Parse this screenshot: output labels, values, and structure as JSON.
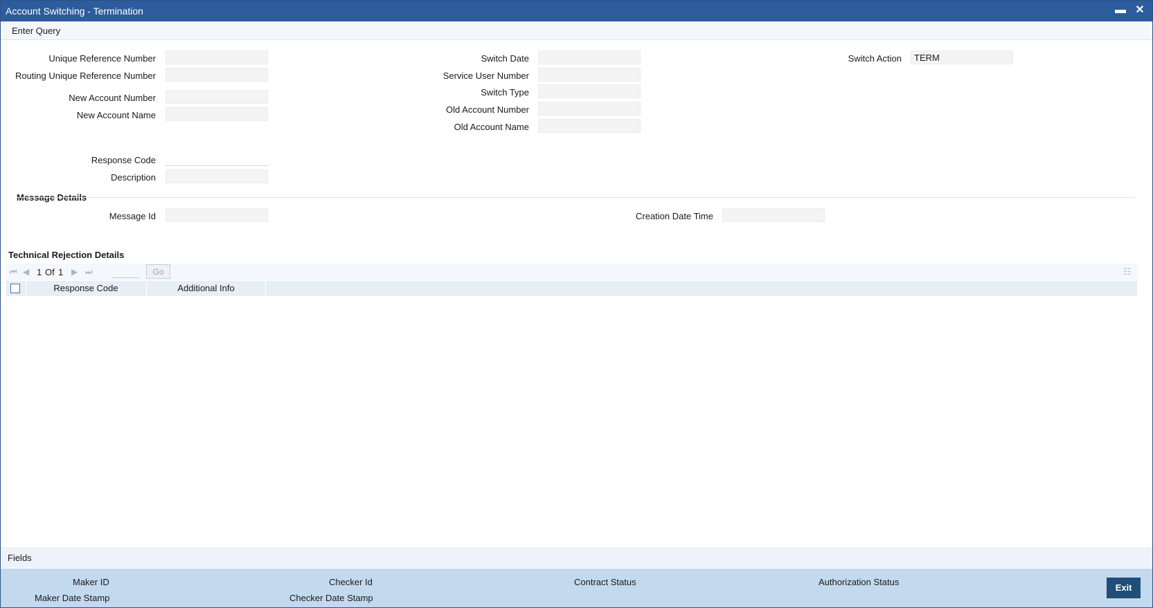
{
  "window": {
    "title": "Account Switching - Termination",
    "minimize_glyph": "▬",
    "close_glyph": "✕"
  },
  "menu": {
    "enter_query": "Enter Query"
  },
  "form": {
    "unique_reference_number": {
      "label": "Unique Reference Number",
      "value": ""
    },
    "routing_unique_reference_number": {
      "label": "Routing Unique Reference Number",
      "value": ""
    },
    "new_account_number": {
      "label": "New Account Number",
      "value": ""
    },
    "new_account_name": {
      "label": "New Account Name",
      "value": ""
    },
    "switch_date": {
      "label": "Switch Date",
      "value": ""
    },
    "service_user_number": {
      "label": "Service User Number",
      "value": ""
    },
    "switch_type": {
      "label": "Switch Type",
      "value": ""
    },
    "old_account_number": {
      "label": "Old Account Number",
      "value": ""
    },
    "old_account_name": {
      "label": "Old Account Name",
      "value": ""
    },
    "switch_action": {
      "label": "Switch Action",
      "value": "TERM"
    },
    "response_code": {
      "label": "Response Code",
      "value": ""
    },
    "description": {
      "label": "Description",
      "value": ""
    }
  },
  "message_details": {
    "title": "Message Details",
    "message_id": {
      "label": "Message Id",
      "value": ""
    },
    "creation_date_time": {
      "label": "Creation Date Time",
      "value": ""
    }
  },
  "technical_rejection": {
    "title": "Technical Rejection Details",
    "pagination": {
      "current": "1",
      "of_label": "Of",
      "total": "1",
      "go_label": "Go"
    },
    "columns": [
      "Response Code",
      "Additional Info"
    ]
  },
  "fields_bar": {
    "label": "Fields"
  },
  "footer": {
    "maker_id": "Maker ID",
    "maker_date_stamp": "Maker Date Stamp",
    "checker_id": "Checker Id",
    "checker_date_stamp": "Checker Date Stamp",
    "contract_status": "Contract Status",
    "authorization_status": "Authorization Status",
    "exit": "Exit"
  },
  "colors": {
    "titlebar": "#2c5c9c",
    "footer": "#c3d9ee",
    "exit_button": "#1f4e79"
  }
}
